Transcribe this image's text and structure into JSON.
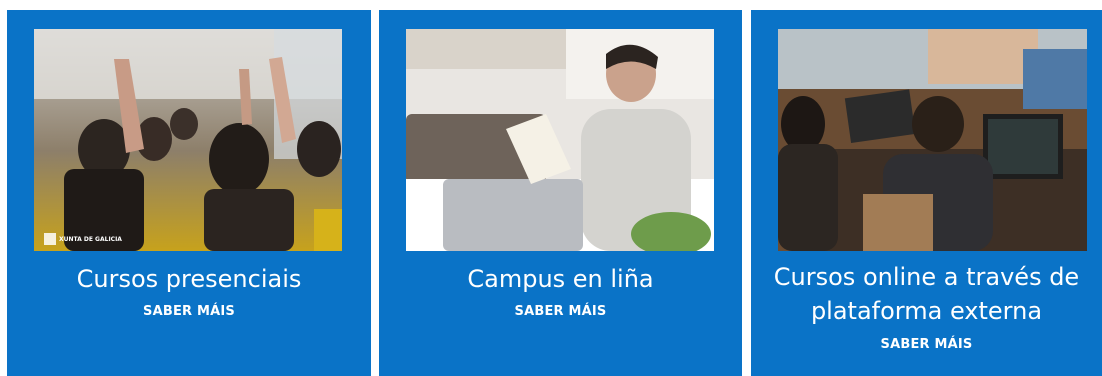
{
  "cards": [
    {
      "title": "Cursos presenciais",
      "link": "SABER MÁIS",
      "logo_text": "XUNTA DE GALICIA"
    },
    {
      "title": "Campus en liña",
      "link": "SABER MÁIS"
    },
    {
      "title": "Cursos online a través de plataforma externa",
      "link": "SABER MÁIS"
    }
  ],
  "colors": {
    "card_bg": "#0a73c7",
    "text": "#ffffff"
  }
}
